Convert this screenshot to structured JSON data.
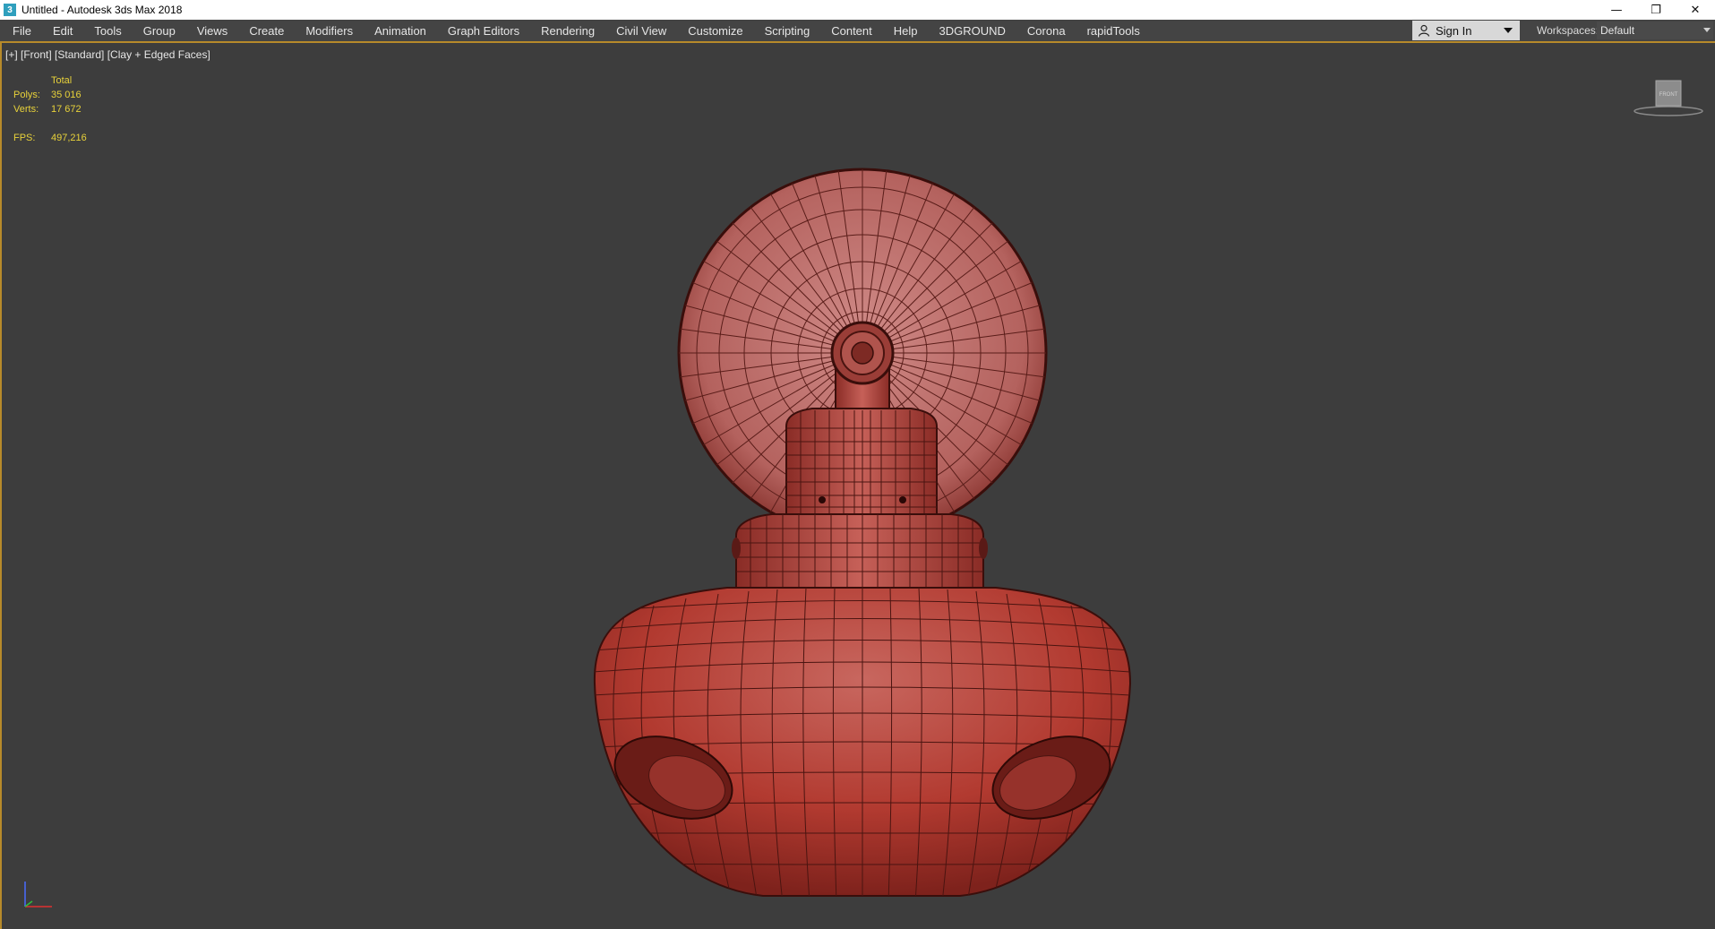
{
  "window": {
    "title": "Untitled - Autodesk 3ds Max 2018",
    "logo_glyph": "3",
    "controls": {
      "minimize": "—",
      "restore": "❐",
      "close": "✕"
    }
  },
  "menubar": {
    "items": [
      "File",
      "Edit",
      "Tools",
      "Group",
      "Views",
      "Create",
      "Modifiers",
      "Animation",
      "Graph Editors",
      "Rendering",
      "Civil View",
      "Customize",
      "Scripting",
      "Content",
      "Help",
      "3DGROUND",
      "Corona",
      "rapidTools"
    ],
    "sign_in": "Sign In",
    "workspaces_label": "Workspaces:",
    "workspace_value": "Default"
  },
  "viewport": {
    "label": "[+] [Front] [Standard] [Clay + Edged Faces]",
    "stats": {
      "header": "Total",
      "polys_label": "Polys:",
      "polys_value": "35 016",
      "verts_label": "Verts:",
      "verts_value": "17 672",
      "fps_label": "FPS:",
      "fps_value": "497,216"
    },
    "viewcube_face": "FRONT"
  },
  "colors": {
    "accent": "#b78a2a",
    "stats_text": "#e8d23a",
    "viewport_bg": "#3d3d3d",
    "model_clay": "#b53a32",
    "model_light": "#c97a76"
  },
  "icons": {
    "user": "user-icon",
    "viewcube": "viewcube-icon",
    "axis": "axis-tripod-icon"
  }
}
